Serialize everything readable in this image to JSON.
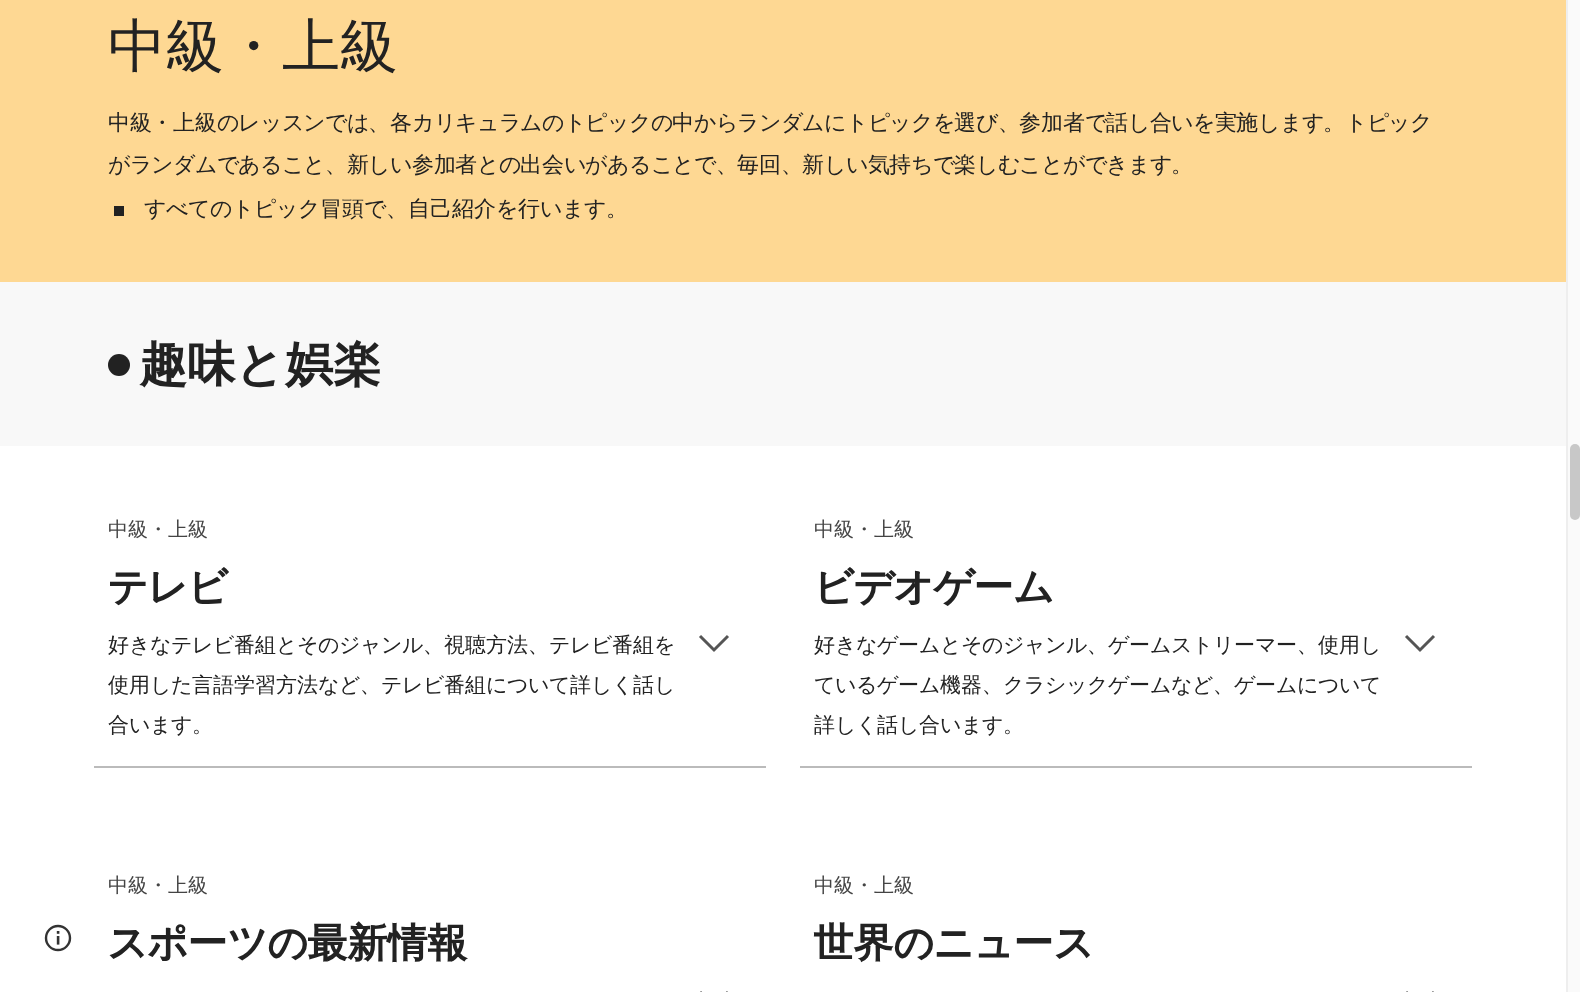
{
  "hero": {
    "title": "中級・上級",
    "description": "中級・上級のレッスンでは、各カリキュラムのトピックの中からランダムにトピックを選び、参加者で話し合いを実施します。トピックがランダムであること、新しい参加者との出会いがあることで、毎回、新しい気持ちで楽しむことができます。",
    "bullets": [
      "すべてのトピック冒頭で、自己紹介を行います。"
    ]
  },
  "section": {
    "title": "趣味と娯楽"
  },
  "cards": [
    {
      "level": "中級・上級",
      "title": "テレビ",
      "description": "好きなテレビ番組とそのジャンル、視聴方法、テレビ番組を使用した言語学習方法など、テレビ番組について詳しく話し合います。",
      "expanded": false
    },
    {
      "level": "中級・上級",
      "title": "ビデオゲーム",
      "description": "好きなゲームとそのジャンル、ゲームストリーマー、使用しているゲーム機器、クラシックゲームなど、ゲームについて詳しく話し合います。",
      "expanded": false
    },
    {
      "level": "中級・上級",
      "title": "スポーツの最新情報",
      "expanded": false
    },
    {
      "level": "中級・上級",
      "title": "世界のニュース",
      "expanded": false
    }
  ]
}
